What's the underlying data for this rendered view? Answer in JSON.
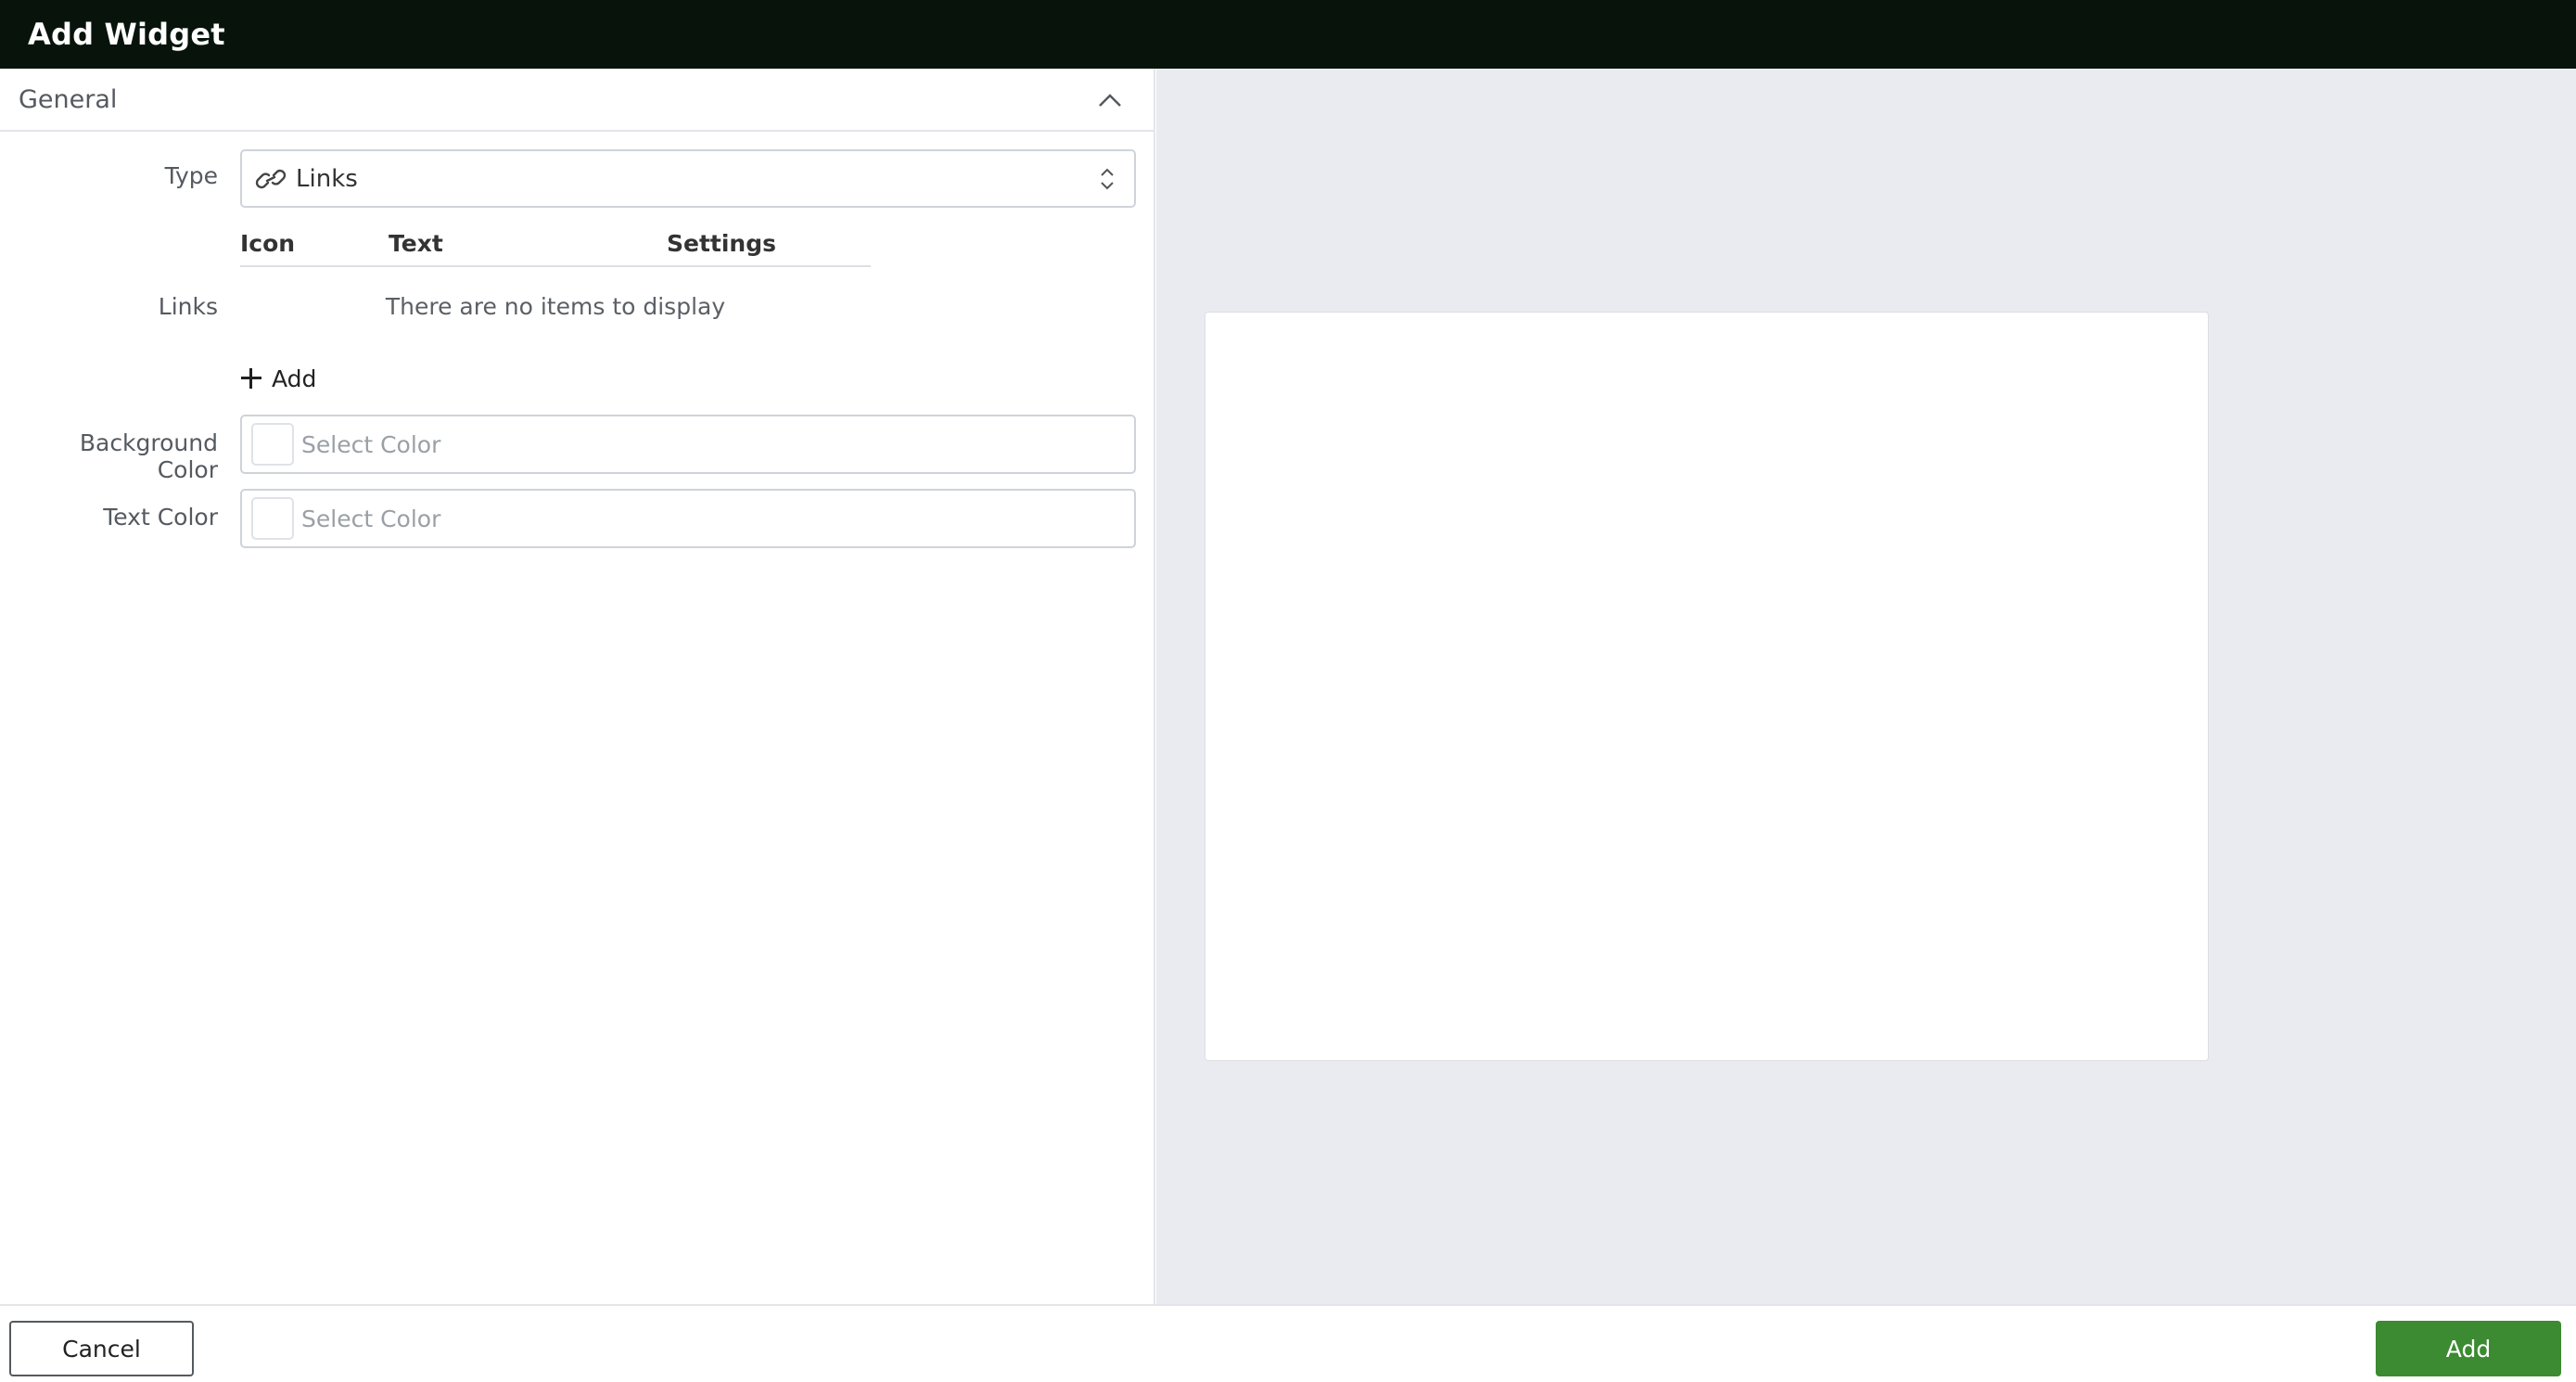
{
  "window": {
    "title": "Add Widget"
  },
  "section": {
    "title": "General",
    "collapse_icon": "chevron-up-icon"
  },
  "type_field": {
    "label": "Type",
    "value": "Links",
    "icon": "link-icon"
  },
  "links_field": {
    "label": "Links",
    "columns": [
      "Icon",
      "Text",
      "Settings"
    ],
    "empty_message": "There are no items to display",
    "add_label": "Add"
  },
  "background_color": {
    "label": "Background Color",
    "placeholder": "Select Color"
  },
  "text_color": {
    "label": "Text Color",
    "placeholder": "Select Color"
  },
  "footer": {
    "cancel_label": "Cancel",
    "add_label": "Add"
  },
  "colors": {
    "titlebar_bg": "#08140b",
    "primary_button": "#3c8a31",
    "preview_bg": "#eaebf0"
  }
}
